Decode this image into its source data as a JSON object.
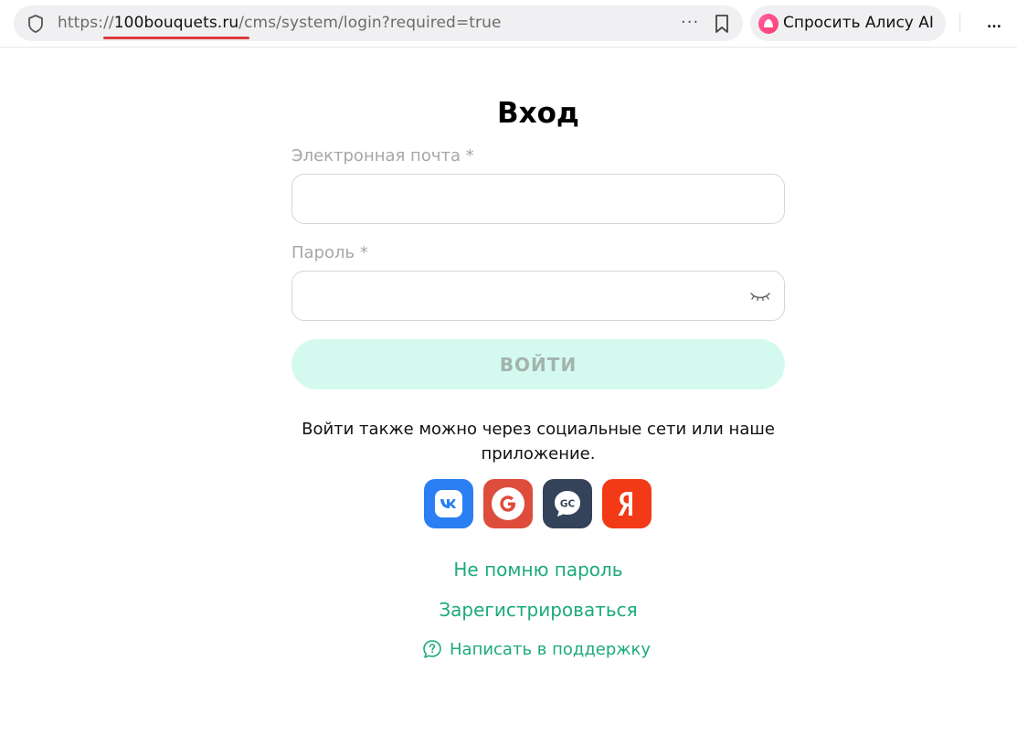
{
  "browser": {
    "url_prefix": "https://",
    "url_domain": "100bouquets.ru",
    "url_path": "/cms/system/login?required=true",
    "more_label": "···",
    "assistant_label": "Спросить Алису AI",
    "menu_label": "..."
  },
  "form": {
    "title": "Вход",
    "email_label": "Электронная почта *",
    "email_value": "",
    "password_label": "Пароль *",
    "password_value": "",
    "submit_label": "ВОЙТИ",
    "social_text": "Войти также можно через социальные сети или наше приложение.",
    "social_providers": [
      {
        "name": "vk-icon",
        "color": "#2b7ff2"
      },
      {
        "name": "google-icon",
        "color": "#de4c3c"
      },
      {
        "name": "gc-icon",
        "color": "#34435a"
      },
      {
        "name": "yandex-icon",
        "color": "#f23a16"
      }
    ],
    "forgot_label": "Не помню пароль",
    "register_label": "Зарегистрироваться",
    "support_label": "Написать в поддержку"
  },
  "colors": {
    "accent": "#1cab7b",
    "button_bg": "#d4faf0",
    "url_highlight": "#d93a3a"
  }
}
